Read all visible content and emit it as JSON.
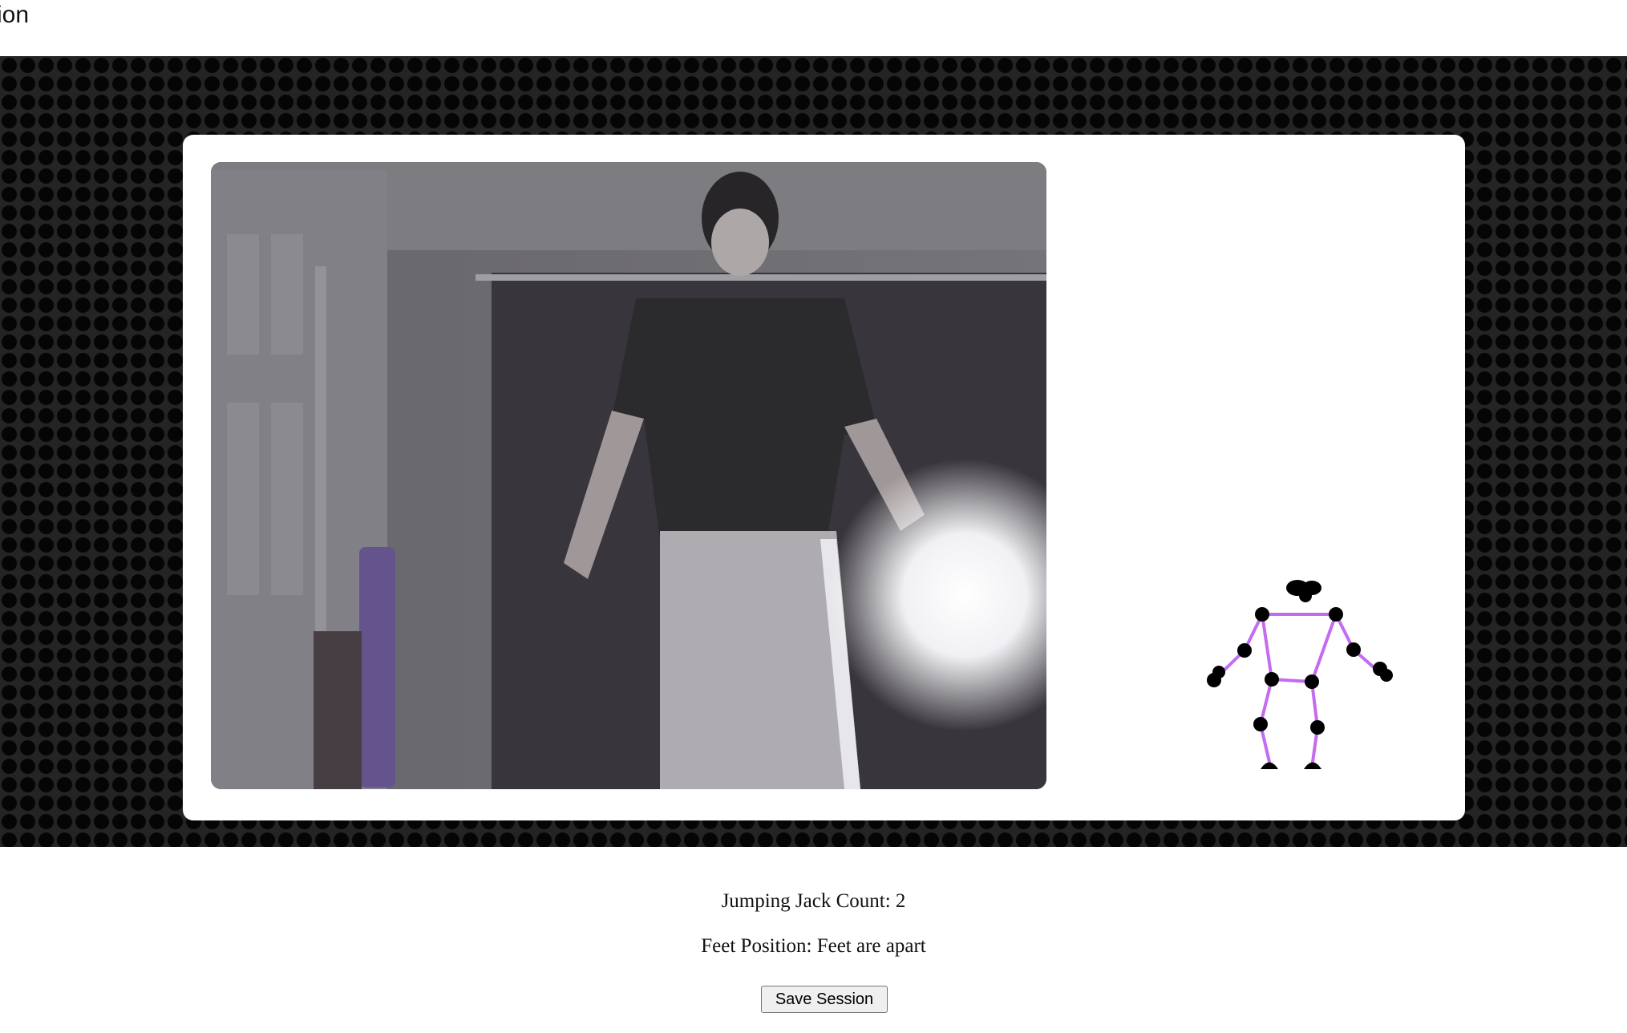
{
  "page": {
    "heading": "ection"
  },
  "stats": {
    "count_label": "Jumping Jack Count: 2",
    "feet_label": "Feet Position: Feet are apart"
  },
  "actions": {
    "save_label": "Save Session"
  },
  "colors": {
    "skeleton_bone": "#c56bf0",
    "skeleton_joint": "#000000",
    "stage_background": "#1b1b1b"
  }
}
